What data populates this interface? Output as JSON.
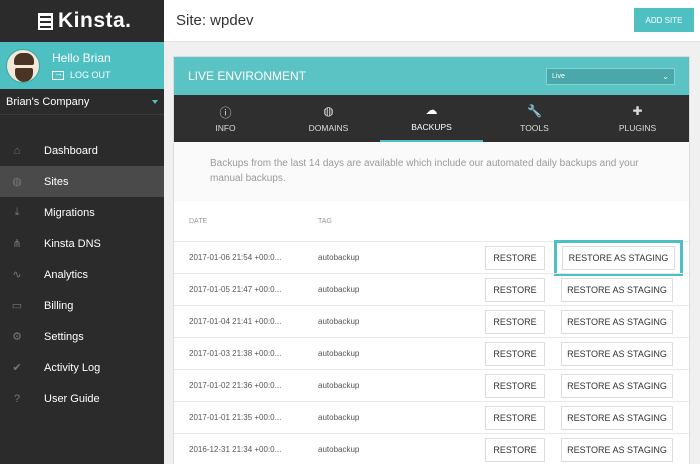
{
  "app": {
    "brand": "Kinsta."
  },
  "user": {
    "greeting": "Hello Brian",
    "logout": "LOG OUT",
    "company": "Brian's Company"
  },
  "nav": [
    {
      "label": "Dashboard",
      "icon": "home-icon",
      "active": false
    },
    {
      "label": "Sites",
      "icon": "globe-icon",
      "active": true
    },
    {
      "label": "Migrations",
      "icon": "migration-icon",
      "active": false
    },
    {
      "label": "Kinsta DNS",
      "icon": "dns-icon",
      "active": false
    },
    {
      "label": "Analytics",
      "icon": "analytics-icon",
      "active": false
    },
    {
      "label": "Billing",
      "icon": "billing-icon",
      "active": false
    },
    {
      "label": "Settings",
      "icon": "gear-icon",
      "active": false
    },
    {
      "label": "Activity Log",
      "icon": "check-icon",
      "active": false
    },
    {
      "label": "User Guide",
      "icon": "help-icon",
      "active": false
    }
  ],
  "header": {
    "title": "Site: wpdev",
    "add_site": "ADD SITE"
  },
  "environment": {
    "title": "LIVE ENVIRONMENT",
    "select_value": "Live"
  },
  "tabs": [
    {
      "label": "INFO",
      "icon": "info-icon"
    },
    {
      "label": "DOMAINS",
      "icon": "globe-icon"
    },
    {
      "label": "BACKUPS",
      "icon": "cloud-upload-icon"
    },
    {
      "label": "TOOLS",
      "icon": "wrench-icon"
    },
    {
      "label": "PLUGINS",
      "icon": "puzzle-icon"
    }
  ],
  "active_tab": "BACKUPS",
  "backups": {
    "description": "Backups from the last 14 days are available which include our automated daily backups and your manual backups.",
    "columns": {
      "date": "DATE",
      "tag": "TAG"
    },
    "restore_label": "RESTORE",
    "staging_label": "RESTORE AS STAGING",
    "rows": [
      {
        "date": "2017-01-06 21:54 +00:0...",
        "tag": "autobackup"
      },
      {
        "date": "2017-01-05 21:47 +00:0...",
        "tag": "autobackup"
      },
      {
        "date": "2017-01-04 21:41 +00:0...",
        "tag": "autobackup"
      },
      {
        "date": "2017-01-03 21:38 +00:0...",
        "tag": "autobackup"
      },
      {
        "date": "2017-01-02 21:36 +00:0...",
        "tag": "autobackup"
      },
      {
        "date": "2017-01-01 21:35 +00:0...",
        "tag": "autobackup"
      },
      {
        "date": "2016-12-31 21:34 +00:0...",
        "tag": "autobackup"
      }
    ]
  },
  "colors": {
    "accent": "#4ec0c2",
    "sidebar": "#2b2b2b",
    "tabs": "#2f2f2f"
  }
}
